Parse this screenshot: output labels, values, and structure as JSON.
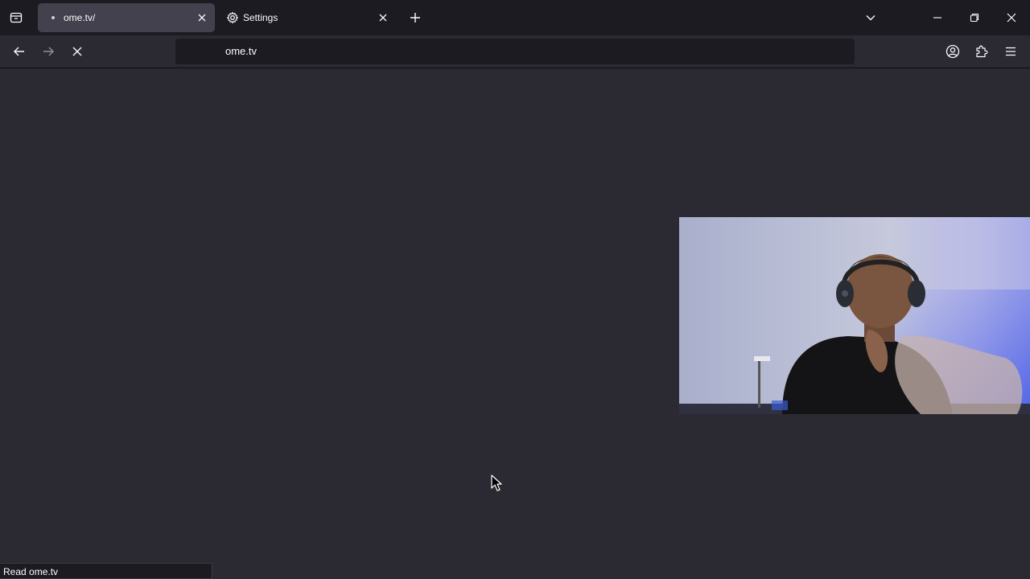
{
  "tabs": [
    {
      "title": "ome.tv/",
      "active": true
    },
    {
      "title": "Settings",
      "active": false
    }
  ],
  "urlbar": {
    "url": "ome.tv"
  },
  "status_text": "Read ome.tv",
  "icons": {
    "list_all_tabs": "list-all-tabs-icon",
    "new_tab": "plus-icon",
    "back": "arrow-left-icon",
    "forward": "arrow-right-icon",
    "stop": "close-icon",
    "account": "account-icon",
    "extensions": "puzzle-icon",
    "menu": "hamburger-icon"
  },
  "colors": {
    "tabstrip_bg": "#1c1b22",
    "toolbar_bg": "#2b2a33",
    "active_tab_bg": "#42414d",
    "text": "#fbfbfe"
  }
}
